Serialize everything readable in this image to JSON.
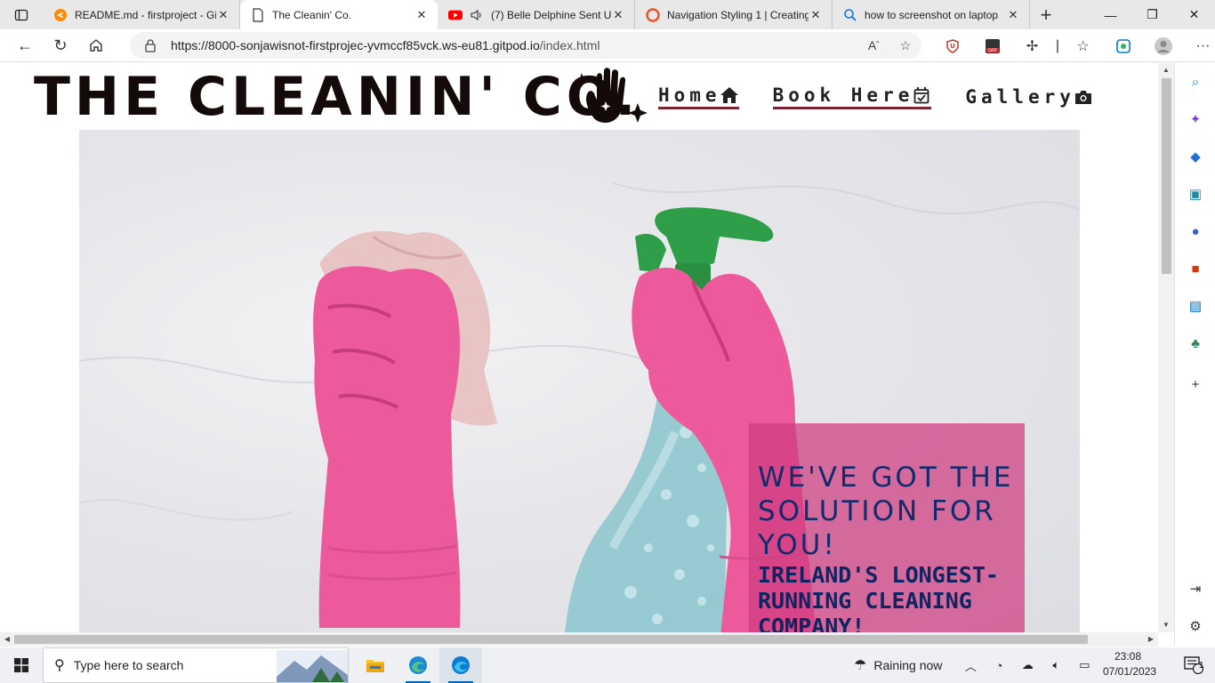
{
  "browser": {
    "tabs": [
      {
        "title": "README.md - firstproject - Gi",
        "icon": "gitpod-icon",
        "active": false
      },
      {
        "title": "The Cleanin' Co.",
        "icon": "page-icon",
        "active": true
      },
      {
        "title": "(7) Belle Delphine Sent U",
        "icon": "youtube-icon",
        "active": false
      },
      {
        "title": "Navigation Styling 1 | Creating",
        "icon": "codeinstitute-icon",
        "active": false
      },
      {
        "title": "how to screenshot on laptop",
        "icon": "search-icon",
        "active": false
      }
    ],
    "url_host": "https://8000-sonjawisnot-firstprojec-yvmccf85vck.ws-eu81.gitpod.io",
    "url_path": "/index.html",
    "accent_color": "#0067c0"
  },
  "site": {
    "logo": "THE CLEANIN' CO.",
    "nav": [
      {
        "label": "Home",
        "icon": "home-icon",
        "underlined": true
      },
      {
        "label": "Book Here",
        "icon": "calendar-check-icon",
        "underlined": true
      },
      {
        "label": "Gallery",
        "icon": "camera-icon",
        "underlined": false
      }
    ],
    "hero": {
      "headline": "WE'VE GOT THE SOLUTION FOR YOU!",
      "subheadline": "IRELAND'S LONGEST-RUNNING CLEANING COMPANY!",
      "card_color": "#ce3c80",
      "text_color": "#132a6b"
    }
  },
  "taskbar": {
    "search_placeholder": "Type here to search",
    "weather": "Raining now",
    "time": "23:08",
    "date": "07/01/2023",
    "notification_count": "1"
  }
}
